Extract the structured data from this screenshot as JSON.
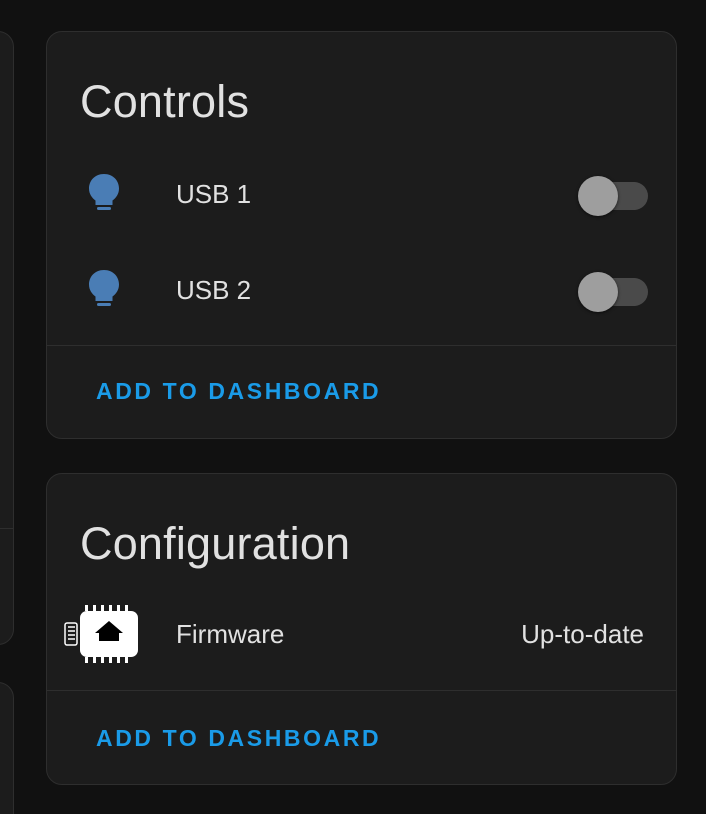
{
  "colors": {
    "background": "#111111",
    "card": "#1c1c1c",
    "accent": "#1a9be8",
    "bulb_icon": "#4a7db5",
    "toggle_off_knob": "#9e9e9e"
  },
  "controls_card": {
    "title": "Controls",
    "entities": [
      {
        "label": "USB 1",
        "icon": "lightbulb-icon",
        "state": "off"
      },
      {
        "label": "USB 2",
        "icon": "lightbulb-icon",
        "state": "off"
      }
    ],
    "action_label": "ADD TO DASHBOARD"
  },
  "configuration_card": {
    "title": "Configuration",
    "entities": [
      {
        "label": "Firmware",
        "icon": "firmware-chip-icon",
        "value": "Up-to-date"
      }
    ],
    "action_label": "ADD TO DASHBOARD"
  }
}
